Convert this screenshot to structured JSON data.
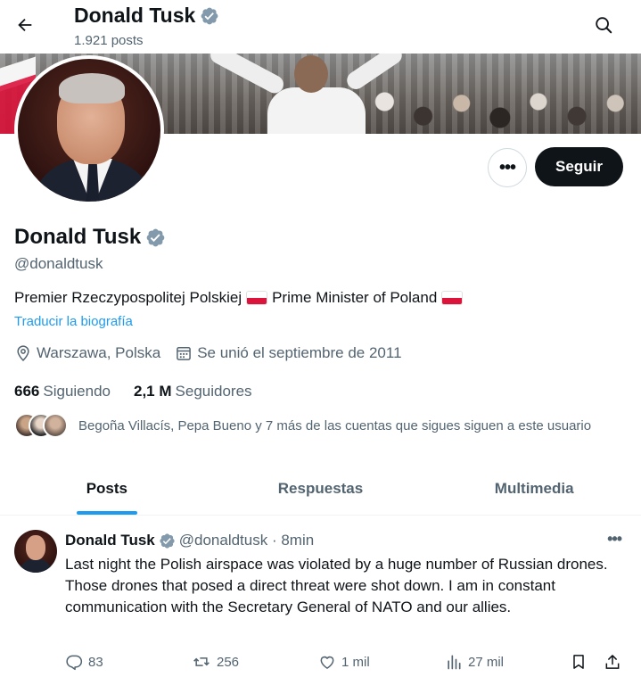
{
  "header": {
    "name": "Donald Tusk",
    "post_count": "1.921 posts"
  },
  "profile": {
    "name": "Donald Tusk",
    "handle": "@donaldtusk",
    "bio_part1": "Premier Rzeczypospolitej Polskiej",
    "bio_part2": "Prime Minister of Poland",
    "translate_label": "Traducir la biografía",
    "location": "Warszawa, Polska",
    "joined": "Se unió el septiembre de 2011",
    "following_count": "666",
    "following_label": "Siguiendo",
    "followers_count": "2,1 M",
    "followers_label": "Seguidores",
    "followed_by": "Begoña Villacís, Pepa Bueno y 7 más de las cuentas que sigues siguen a este usuario",
    "more_label": "•••",
    "follow_label": "Seguir"
  },
  "tabs": [
    {
      "label": "Posts",
      "active": true
    },
    {
      "label": "Respuestas",
      "active": false
    },
    {
      "label": "Multimedia",
      "active": false
    }
  ],
  "post": {
    "author": "Donald Tusk",
    "handle_time": "@donaldtusk · 8min",
    "more_label": "•••",
    "text": "Last night the Polish airspace was violated by a huge number of Russian drones. Those drones that posed  a direct threat were shot down. I am in constant communication with the Secretary General of NATO and our allies.",
    "replies": "83",
    "reposts": "256",
    "likes": "1 mil",
    "views": "27 mil"
  },
  "colors": {
    "accent": "#1d9bf0",
    "text": "#0f1419",
    "muted": "#536471",
    "verified": "#829aab",
    "flag_red": "#dc143c"
  },
  "icons": [
    "back-arrow-icon",
    "search-icon",
    "verified-badge-icon",
    "location-pin-icon",
    "calendar-icon",
    "reply-icon",
    "repost-icon",
    "like-icon",
    "views-icon",
    "bookmark-icon",
    "share-icon"
  ]
}
